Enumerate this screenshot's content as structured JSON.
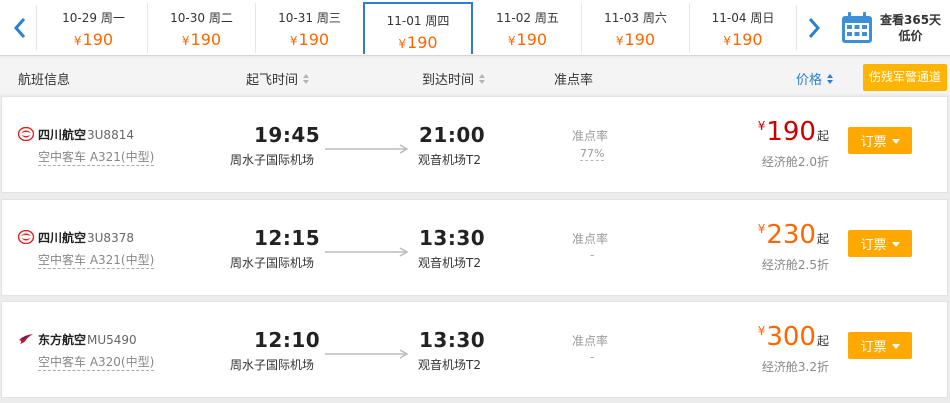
{
  "date_strip": {
    "currency": "¥",
    "dates": [
      {
        "label": "10-29 周一",
        "price": "190",
        "active": false
      },
      {
        "label": "10-30 周二",
        "price": "190",
        "active": false
      },
      {
        "label": "10-31 周三",
        "price": "190",
        "active": false
      },
      {
        "label": "11-01 周四",
        "price": "190",
        "active": true
      },
      {
        "label": "11-02 周五",
        "price": "190",
        "active": false
      },
      {
        "label": "11-03 周六",
        "price": "190",
        "active": false
      },
      {
        "label": "11-04 周日",
        "price": "190",
        "active": false
      }
    ],
    "calendar_line1": "查看365天",
    "calendar_line2": "低价"
  },
  "header": {
    "flight_info": "航班信息",
    "depart_time": "起飞时间",
    "arrive_time": "到达时间",
    "on_time_rate": "准点率",
    "price": "价格",
    "army_channel": "伤残军警通道"
  },
  "flights": [
    {
      "airline": "四川航空",
      "flight_no": "3U8814",
      "aircraft": "空中客车 A321(中型)",
      "dep_time": "19:45",
      "dep_airport": "周水子国际机场",
      "arr_time": "21:00",
      "arr_airport": "观音机场T2",
      "on_time_label": "准点率",
      "on_time_value": "77%",
      "currency": "¥",
      "price": "190",
      "price_suffix": "起",
      "cabin": "经济舱2.0折",
      "book_label": "订票",
      "price_color": "#c80000"
    },
    {
      "airline": "四川航空",
      "flight_no": "3U8378",
      "aircraft": "空中客车 A321(中型)",
      "dep_time": "12:15",
      "dep_airport": "周水子国际机场",
      "arr_time": "13:30",
      "arr_airport": "观音机场T2",
      "on_time_label": "准点率",
      "on_time_value": "-",
      "currency": "¥",
      "price": "230",
      "price_suffix": "起",
      "cabin": "经济舱2.5折",
      "book_label": "订票",
      "price_color": "#ff6600"
    },
    {
      "airline": "东方航空",
      "flight_no": "MU5490",
      "aircraft": "空中客车 A320(中型)",
      "dep_time": "12:10",
      "dep_airport": "周水子国际机场",
      "arr_time": "13:30",
      "arr_airport": "观音机场T2",
      "on_time_label": "准点率",
      "on_time_value": "-",
      "currency": "¥",
      "price": "300",
      "price_suffix": "起",
      "cabin": "经济舱3.2折",
      "book_label": "订票",
      "price_color": "#ff6600"
    }
  ],
  "icons": {
    "prev": "chevron-left-icon",
    "next": "chevron-right-icon",
    "calendar": "calendar-icon",
    "sichuan_logo": "sichuan-airlines-logo-icon",
    "eastern_logo": "china-eastern-logo-icon"
  },
  "colors": {
    "accent_blue": "#2a7fd0",
    "price_orange": "#ff6600",
    "price_red": "#c80000",
    "button_orange": "#ffa800"
  }
}
